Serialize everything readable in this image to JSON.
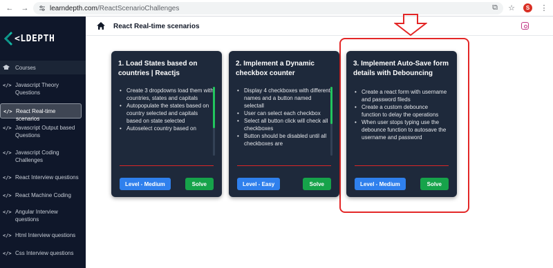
{
  "browser": {
    "url_domain": "learndepth.com",
    "url_path": "/ReactScenarioChallenges",
    "profile_initial": "S"
  },
  "sidebar": {
    "logo": "LDEPTH",
    "logo_prefix": "<",
    "items": [
      {
        "label": "Courses",
        "icon": "mortarboard-icon"
      },
      {
        "label": "Javascript Theory Questions",
        "icon": "code-icon"
      },
      {
        "label": "React Real-time scenarios",
        "icon": "code-icon"
      },
      {
        "label": "Javascript Output based Questions",
        "icon": "code-icon"
      },
      {
        "label": "Javascript Coding Challenges",
        "icon": "code-icon"
      },
      {
        "label": "React Interview questions",
        "icon": "code-icon"
      },
      {
        "label": "React Machine Coding",
        "icon": "code-icon"
      },
      {
        "label": "Angular Interview questions",
        "icon": "code-icon"
      },
      {
        "label": "Html Interview questions",
        "icon": "code-icon"
      },
      {
        "label": "Css Interview questions",
        "icon": "code-icon"
      }
    ],
    "code_glyph": "</>"
  },
  "header": {
    "title": "React Real-time scenarios"
  },
  "cards": [
    {
      "title": "1. Load States based on countries | Reactjs",
      "points": [
        "Create 3 dropdowns load them with countries, states and capitals",
        "Autopopulate the states based on country selected and capitals based on state selected",
        "Autoselect country based on"
      ],
      "level": "Level - Medium",
      "solve": "Solve"
    },
    {
      "title": "2. Implement a Dynamic checkbox counter",
      "points": [
        "Display 4 checkboxes with different names and a button named selectall",
        "User can select each checkbox",
        "Select all button click will check all checkboxes",
        "Button should be disabled until all checkboxes are"
      ],
      "level": "Level - Easy",
      "solve": "Solve"
    },
    {
      "title": "3. Implement Auto-Save form details with Debouncing",
      "points": [
        "Create a react form with username and password fileds",
        "Create a custom debounce function to delay the operations",
        "When user stops typing use the debounce function to autosave the username and password"
      ],
      "level": "Level - Medium",
      "solve": "Solve"
    }
  ],
  "colors": {
    "sidebar_bg": "#0f172a",
    "card_bg": "#1e293b",
    "level_button": "#2f80ed",
    "solve_button": "#16a34a",
    "annotation_red": "#e32626"
  }
}
